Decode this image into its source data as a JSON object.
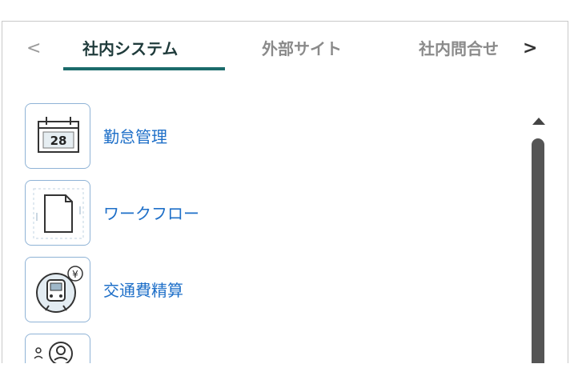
{
  "tabs": {
    "prev_arrow": "<",
    "next_arrow": ">",
    "items": [
      {
        "label": "社内システム"
      },
      {
        "label": "外部サイト"
      },
      {
        "label": "社内問合せ"
      }
    ],
    "active_index": 0
  },
  "list": {
    "items": [
      {
        "label": "勤怠管理",
        "icon": "calendar-icon",
        "icon_text": "28"
      },
      {
        "label": "ワークフロー",
        "icon": "document-icon"
      },
      {
        "label": "交通費精算",
        "icon": "train-yen-icon",
        "icon_text": "¥"
      },
      {
        "label": "",
        "icon": "people-icon"
      }
    ]
  },
  "colors": {
    "accent": "#1b6b6b",
    "link": "#1e6fc8",
    "icon_border": "#8fb3d6",
    "scrollbar": "#555555"
  }
}
